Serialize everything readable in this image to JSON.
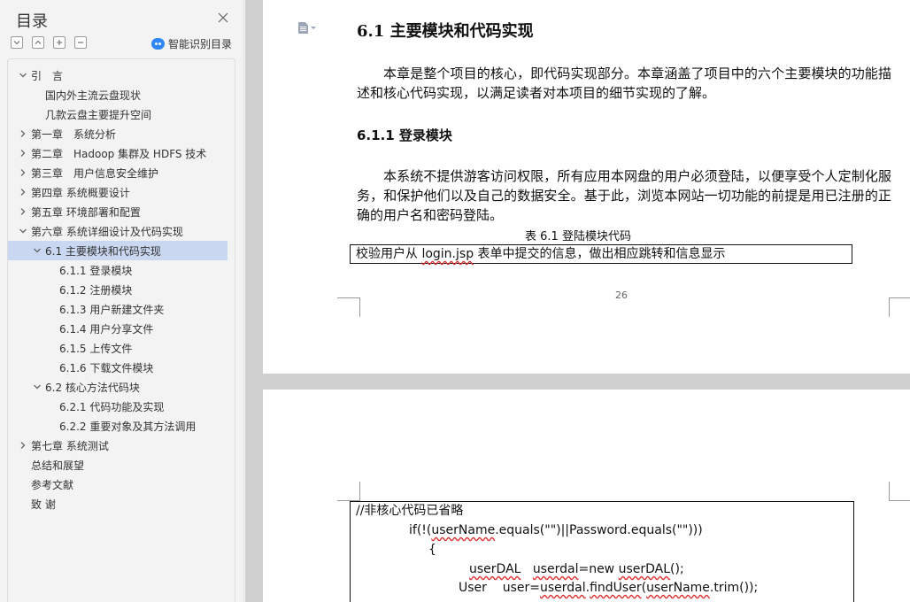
{
  "sidebar": {
    "title": "目录",
    "smart_label": "智能识别目录",
    "icons": {
      "close": "close-icon",
      "collapse": "collapse-all-icon",
      "expand": "expand-all-icon",
      "add": "add-level-icon",
      "remove": "remove-level-icon"
    },
    "items": [
      {
        "label": "引　言",
        "level": 1,
        "caret": "down"
      },
      {
        "label": "国内外主流云盘现状",
        "level": 2,
        "caret": "none"
      },
      {
        "label": "几款云盘主要提升空间",
        "level": 2,
        "caret": "none"
      },
      {
        "label": "第一章　系统分析",
        "level": 1,
        "caret": "right"
      },
      {
        "label": "第二章　Hadoop 集群及 HDFS 技术",
        "level": 1,
        "caret": "right"
      },
      {
        "label": "第三章　用户信息安全维护",
        "level": 1,
        "caret": "right"
      },
      {
        "label": "第四章  系统概要设计",
        "level": 1,
        "caret": "right"
      },
      {
        "label": "第五章  环境部署和配置",
        "level": 1,
        "caret": "right"
      },
      {
        "label": "第六章  系统详细设计及代码实现",
        "level": 1,
        "caret": "down"
      },
      {
        "label": "6.1 主要模块和代码实现",
        "level": 2,
        "caret": "down",
        "active": true
      },
      {
        "label": "6.1.1  登录模块",
        "level": 3,
        "caret": "none"
      },
      {
        "label": "6.1.2 注册模块",
        "level": 3,
        "caret": "none"
      },
      {
        "label": "6.1.3 用户新建文件夹",
        "level": 3,
        "caret": "none"
      },
      {
        "label": "6.1.4 用户分享文件",
        "level": 3,
        "caret": "none"
      },
      {
        "label": "6.1.5 上传文件",
        "level": 3,
        "caret": "none"
      },
      {
        "label": "6.1.6 下载文件模块",
        "level": 3,
        "caret": "none"
      },
      {
        "label": "6.2 核心方法代码块",
        "level": 2,
        "caret": "down"
      },
      {
        "label": "6.2.1  代码功能及实现",
        "level": 3,
        "caret": "none"
      },
      {
        "label": "6.2.2  重要对象及其方法调用",
        "level": 3,
        "caret": "none"
      },
      {
        "label": "第七章  系统测试",
        "level": 1,
        "caret": "right"
      },
      {
        "label": "总结和展望",
        "level": 1,
        "caret": "none"
      },
      {
        "label": "参考文献",
        "level": 1,
        "caret": "none"
      },
      {
        "label": "致 谢",
        "level": 1,
        "caret": "none"
      }
    ]
  },
  "document": {
    "page1": {
      "heading": "6.1 主要模块和代码实现",
      "para1": "本章是整个项目的核心，即代码实现部分。本章涵盖了项目中的六个主要模块的功能描述和核心代码实现，以满足读者对本项目的细节实现的了解。",
      "subheading": "6.1.1  登录模块",
      "para2": "本系统不提供游客访问权限，所有应用本网盘的用户必须登陆，以便享受个人定制化服务，和保护他们以及自己的数据安全。基于此，浏览本网站一切功能的前提是用已注册的正确的用户名和密码登陆。",
      "caption": "表 6.1  登陆模块代码",
      "table_cell": "校验用户从 login.jsp 表单中提交的信息，做出相应跳转和信息显示",
      "page_number": "26"
    },
    "page2": {
      "code_lines": [
        "//非核心代码已省略",
        "if(!(userName.equals(\"\")||Password.equals(\"\")))",
        "{",
        "userDAL   userdal=new userDAL();",
        "User    user=userdal.findUser(userName.trim());"
      ]
    }
  }
}
